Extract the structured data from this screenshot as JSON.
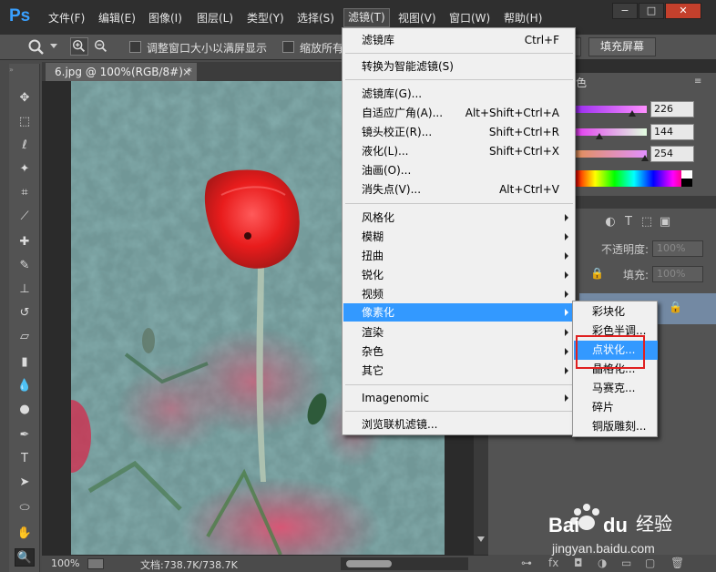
{
  "app": {
    "logo": "Ps"
  },
  "menu_bar": {
    "items": [
      "文件(F)",
      "编辑(E)",
      "图像(I)",
      "图层(L)",
      "类型(Y)",
      "选择(S)",
      "滤镜(T)",
      "视图(V)",
      "窗口(W)",
      "帮助(H)"
    ],
    "window_controls": {
      "minimize": "−",
      "restore": "□",
      "close": "✕"
    }
  },
  "options_bar": {
    "resize_windows_label": "调整窗口大小以满屏显示",
    "zoom_all_label": "缩放所有",
    "fill_screen_button": "填充屏幕"
  },
  "document": {
    "tab_title": "6.jpg @ 100%(RGB/8#) *",
    "tab_close": "×",
    "zoom": "100%",
    "doc_size": "文档:738.7K/738.7K"
  },
  "color_panel": {
    "title": "色",
    "values": [
      "226",
      "144",
      "254"
    ]
  },
  "layers_panel": {
    "opacity_label": "不透明度:",
    "opacity_value": "100%",
    "fill_label": "填充:",
    "fill_value": "100%"
  },
  "filter_menu": {
    "items": [
      {
        "label": "滤镜库",
        "shortcut": "Ctrl+F"
      },
      {
        "label": "转换为智能滤镜(S)",
        "shortcut": ""
      },
      {
        "label": "滤镜库(G)...",
        "shortcut": ""
      },
      {
        "label": "自适应广角(A)...",
        "shortcut": "Alt+Shift+Ctrl+A"
      },
      {
        "label": "镜头校正(R)...",
        "shortcut": "Shift+Ctrl+R"
      },
      {
        "label": "液化(L)...",
        "shortcut": "Shift+Ctrl+X"
      },
      {
        "label": "油画(O)...",
        "shortcut": ""
      },
      {
        "label": "消失点(V)...",
        "shortcut": "Alt+Ctrl+V"
      },
      {
        "label": "风格化",
        "shortcut": ""
      },
      {
        "label": "模糊",
        "shortcut": ""
      },
      {
        "label": "扭曲",
        "shortcut": ""
      },
      {
        "label": "锐化",
        "shortcut": ""
      },
      {
        "label": "视频",
        "shortcut": ""
      },
      {
        "label": "像素化",
        "shortcut": ""
      },
      {
        "label": "渲染",
        "shortcut": ""
      },
      {
        "label": "杂色",
        "shortcut": ""
      },
      {
        "label": "其它",
        "shortcut": ""
      },
      {
        "label": "Imagenomic",
        "shortcut": ""
      },
      {
        "label": "浏览联机滤镜...",
        "shortcut": ""
      }
    ]
  },
  "pixelate_submenu": {
    "items": [
      "彩块化",
      "彩色半调...",
      "点状化...",
      "晶格化...",
      "马赛克...",
      "碎片",
      "铜版雕刻..."
    ]
  },
  "watermark": {
    "text": "jingyan.baidu.com"
  },
  "colors": {
    "accent": "#3399ff",
    "highlight_box": "#e02020"
  }
}
